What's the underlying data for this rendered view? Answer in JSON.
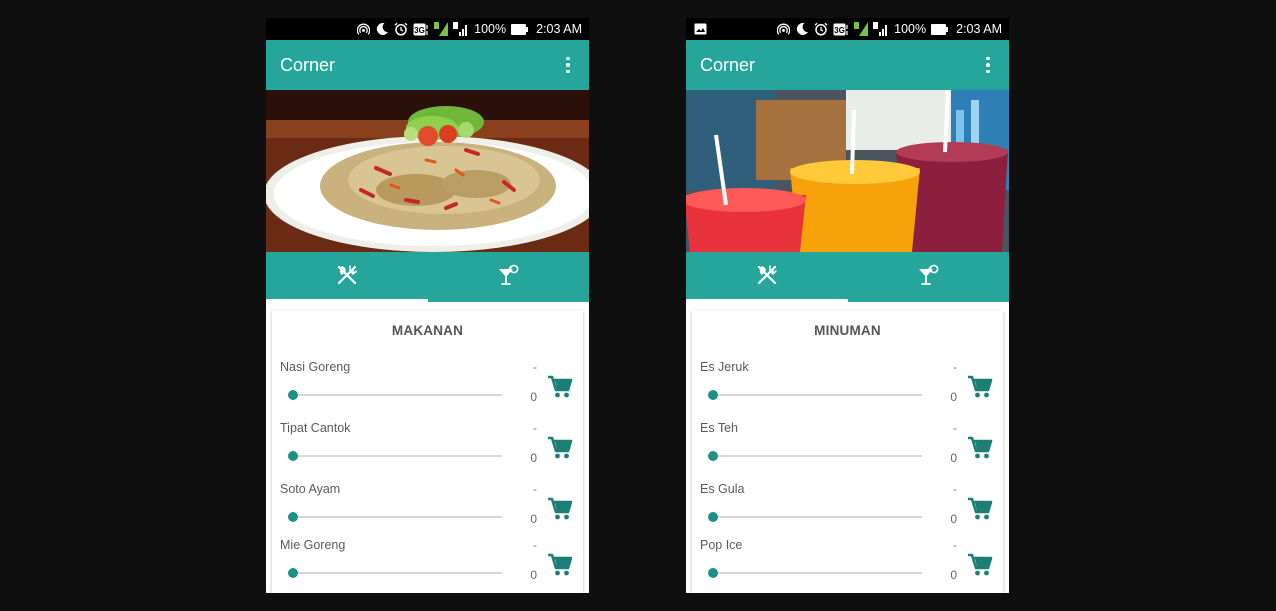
{
  "statusbar": {
    "battery": "100%",
    "time": "2:03 AM",
    "network": "3G"
  },
  "colors": {
    "primary": "#26a69a",
    "accent": "#1e9086",
    "cart": "#1b7f76"
  },
  "screens": [
    {
      "app_title": "Corner",
      "hero": "fried-rice-plate-image",
      "tabs": [
        {
          "icon": "cutlery-icon",
          "selected": true
        },
        {
          "icon": "cocktail-icon",
          "selected": false
        }
      ],
      "section_title": "MAKANAN",
      "items": [
        {
          "name": "Nasi Goreng",
          "dash": "-",
          "qty": "0",
          "slider": 0
        },
        {
          "name": "Tipat Cantok",
          "dash": "-",
          "qty": "0",
          "slider": 0
        },
        {
          "name": "Soto Ayam",
          "dash": "-",
          "qty": "0",
          "slider": 0
        },
        {
          "name": "Mie Goreng",
          "dash": "-",
          "qty": "0",
          "slider": 0
        }
      ]
    },
    {
      "app_title": "Corner",
      "hero": "juice-glasses-image",
      "tabs": [
        {
          "icon": "cutlery-icon",
          "selected": true
        },
        {
          "icon": "cocktail-icon",
          "selected": false
        }
      ],
      "section_title": "MINUMAN",
      "items": [
        {
          "name": "Es Jeruk",
          "dash": "-",
          "qty": "0",
          "slider": 0
        },
        {
          "name": "Es Teh",
          "dash": "-",
          "qty": "0",
          "slider": 0
        },
        {
          "name": "Es Gula",
          "dash": "-",
          "qty": "0",
          "slider": 0
        },
        {
          "name": "Pop Ice",
          "dash": "-",
          "qty": "0",
          "slider": 0
        }
      ]
    }
  ]
}
